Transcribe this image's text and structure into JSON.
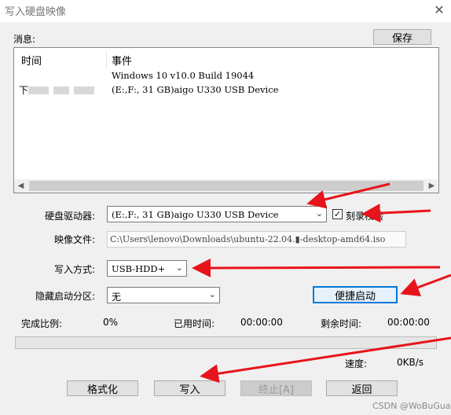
{
  "window": {
    "title": "写入硬盘映像",
    "close_glyph": "✕"
  },
  "messages": {
    "label": "消息:",
    "save_button": "保存",
    "col_time": "时间",
    "col_event": "事件",
    "rows": [
      {
        "time": "",
        "event": "Windows 10 v10.0 Build 19044"
      },
      {
        "time": "下",
        "event": "(E:,F:, 31 GB)aigo U330 USB Device"
      }
    ]
  },
  "drive": {
    "label": "硬盘驱动器:",
    "value": "(E:,F:, 31 GB)aigo U330 USB Device"
  },
  "verify": {
    "label": "刻录校验",
    "checked": true,
    "check_glyph": "✓"
  },
  "image_file": {
    "label": "映像文件:",
    "value": "C:\\Users\\lenovo\\Downloads\\ubuntu-22.04.▮-desktop-amd64.iso"
  },
  "write_mode": {
    "label": "写入方式:",
    "value": "USB-HDD+"
  },
  "hidden_partition": {
    "label": "隐藏启动分区:",
    "value": "无"
  },
  "quick_boot_button": "便捷启动",
  "progress": {
    "complete_label": "完成比例:",
    "complete_value": "0%",
    "elapsed_label": "已用时间:",
    "elapsed_value": "00:00:00",
    "remaining_label": "剩余时间:",
    "remaining_value": "00:00:00",
    "fraction": 0,
    "speed_label": "速度:",
    "speed_value": "0KB/s"
  },
  "buttons": {
    "format": "格式化",
    "write": "写入",
    "stop": "终止[A]",
    "back": "返回"
  },
  "watermark": "CSDN @WoBuGuaiguai",
  "colors": {
    "annotation_arrow": "#e8141b",
    "default_button_border": "#0078d7"
  }
}
